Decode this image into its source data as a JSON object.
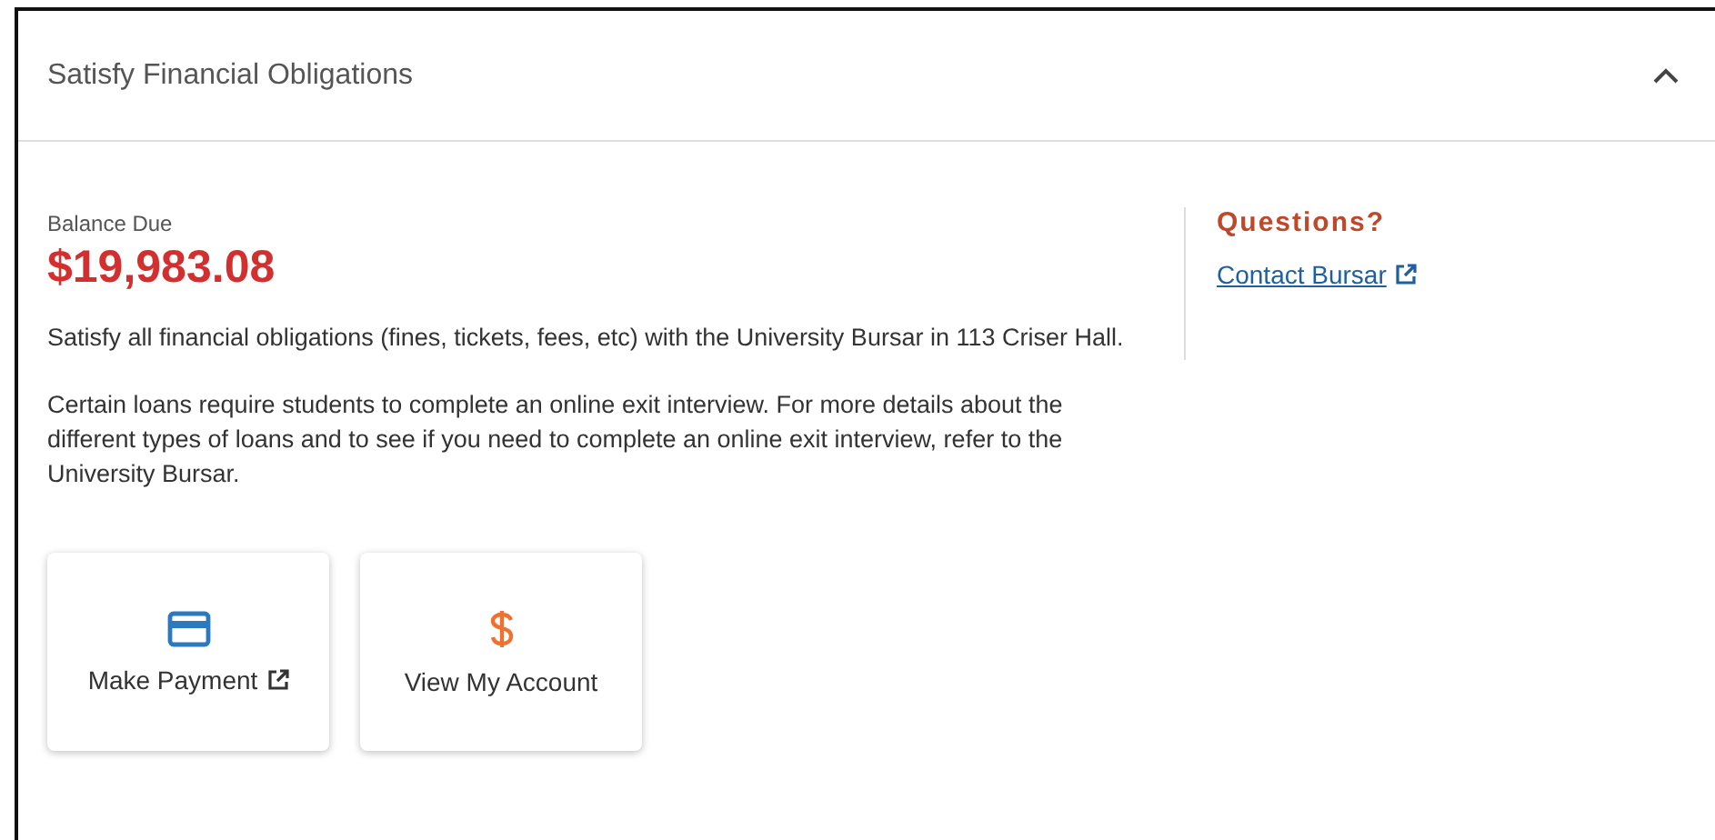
{
  "panel": {
    "title": "Satisfy Financial Obligations",
    "expanded": true
  },
  "balance": {
    "label": "Balance Due",
    "amount": "$19,983.08"
  },
  "paragraphs": [
    "Satisfy all financial obligations (fines, tickets, fees, etc) with the University Bursar in 113 Criser Hall.",
    "Certain loans require students to complete an online exit interview. For more details about the different types of loans and to see if you need to complete an online exit interview, refer to the University Bursar."
  ],
  "questions": {
    "heading": "Questions?",
    "link": "Contact Bursar",
    "external": true
  },
  "actions": [
    {
      "kind": "card",
      "label": "Make Payment",
      "external": true
    },
    {
      "kind": "dollar",
      "label": "View My Account",
      "external": false
    }
  ]
}
